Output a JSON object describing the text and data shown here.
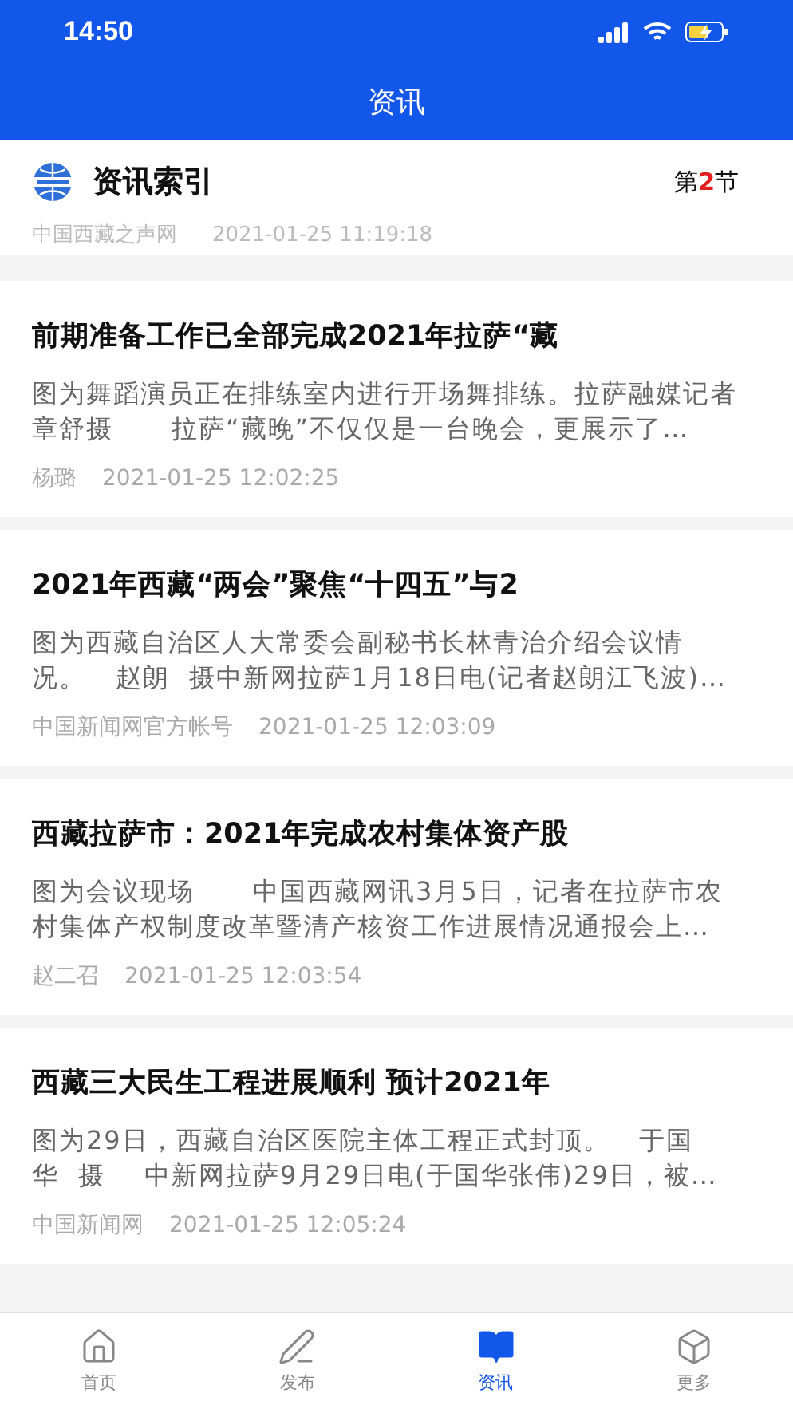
{
  "status_bar": {
    "time": "14:50"
  },
  "title": "资讯",
  "section": {
    "title": "资讯索引",
    "prefix": "第",
    "number": "2",
    "suffix": "节"
  },
  "partial_item": {
    "source": "中国西藏之声网",
    "time": "2021-01-25 11:19:18"
  },
  "articles": [
    {
      "title": "前期准备工作已全部完成2021年拉萨“藏",
      "summary": "图为舞蹈演员正在排练室内进行开场舞排练。拉萨融媒记者章舒摄      拉萨“藏晚”不仅仅是一台晚会，更展示了…",
      "source": "杨璐",
      "time": "2021-01-25 12:02:25"
    },
    {
      "title": "2021年西藏“两会”聚焦“十四五”与2",
      "summary": "图为西藏自治区人大常委会副秘书长林青治介绍会议情况。   赵朗  摄中新网拉萨1月18日电(记者赵朗江飞波)…",
      "source": "中国新闻网官方帐号",
      "time": "2021-01-25 12:03:09"
    },
    {
      "title": "西藏拉萨市：2021年完成农村集体资产股",
      "summary": "图为会议现场      中国西藏网讯3月5日，记者在拉萨市农村集体产权制度改革暨清产核资工作进展情况通报会上…",
      "source": "赵二召",
      "time": "2021-01-25 12:03:54"
    },
    {
      "title": "西藏三大民生工程进展顺利 预计2021年",
      "summary": "图为29日，西藏自治区医院主体工程正式封顶。   于国华  摄    中新网拉萨9月29日电(于国华张伟)29日，被…",
      "source": "中国新闻网",
      "time": "2021-01-25 12:05:24"
    }
  ],
  "tabs": [
    {
      "kind": "home",
      "label": "首页",
      "selected": false
    },
    {
      "kind": "publish",
      "label": "发布",
      "selected": false
    },
    {
      "kind": "news",
      "label": "资讯",
      "selected": true
    },
    {
      "kind": "more",
      "label": "更多",
      "selected": false
    }
  ]
}
